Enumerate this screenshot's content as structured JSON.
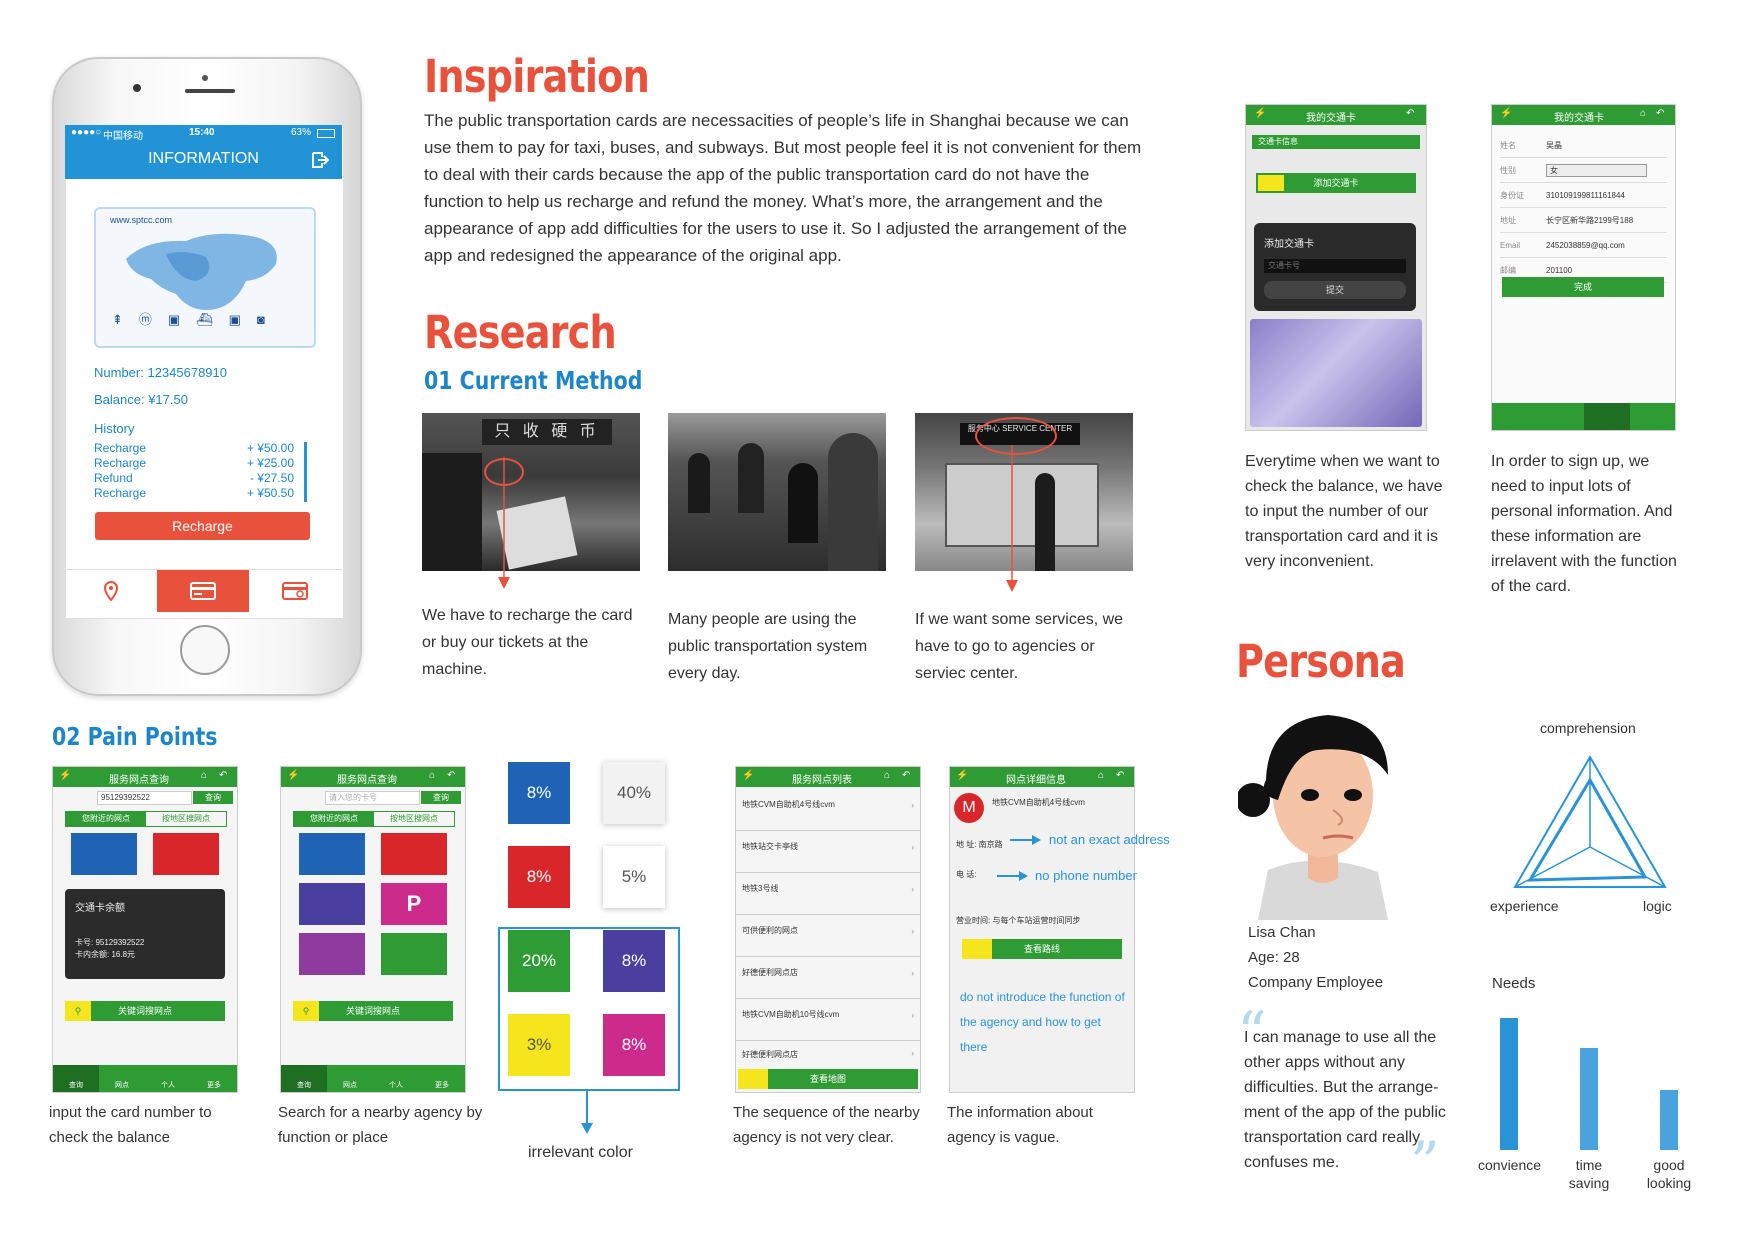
{
  "phone": {
    "status_carrier": "中国移动",
    "status_time": "15:40",
    "status_battery": "63%",
    "header_title": "INFORMATION",
    "card_url": "www.sptcc.com",
    "number": "Number: 12345678910",
    "balance": "Balance: ¥17.50",
    "history_label": "History",
    "history": [
      {
        "type": "Recharge",
        "amount": "+ ¥50.00"
      },
      {
        "type": "Recharge",
        "amount": "+ ¥25.00"
      },
      {
        "type": "Refund",
        "amount": "- ¥27.50"
      },
      {
        "type": "Recharge",
        "amount": "+ ¥50.50"
      }
    ],
    "recharge_button": "Recharge"
  },
  "inspiration": {
    "title": "Inspiration",
    "text": "The public transportation cards are necessacities of people’s life in Shanghai because we can use them to pay for taxi, buses, and subways. But most people feel it is not convenient for them to deal with their cards because the app of the public transportation card do not have the function to help us recharge and refund the money. What’s more, the arrangement and the appearance of app add difficulties for the users to use it. So I adjusted the arrangement of the app and redesigned the appearance of the original app."
  },
  "research": {
    "title": "Research",
    "subtitle": "01 Current Method",
    "photo_signs": [
      "只 收 硬 币",
      "服务中心 SERVICE CENTER"
    ],
    "captions": [
      "We have to recharge the card or buy our tickets at the machine.",
      "Many people are using the public transportation system every day.",
      "If we want some services, we have to go to agencies or serviec center."
    ]
  },
  "screens_top": {
    "header": "我的交通卡",
    "screen1": {
      "section": "交通卡信息",
      "add_card": "添加交通卡",
      "dialog_title": "添加交通卡",
      "dialog_field": "交通卡号",
      "dialog_submit": "提交"
    },
    "screen2": {
      "fields": [
        {
          "label": "姓名",
          "value": "吴晶"
        },
        {
          "label": "性别",
          "value": "女"
        },
        {
          "label": "身份证",
          "value": "310109199811161844"
        },
        {
          "label": "地址",
          "value": "长宁区新华路2199号188"
        },
        {
          "label": "Email",
          "value": "2452038859@qq.com"
        },
        {
          "label": "邮编",
          "value": "201100"
        }
      ],
      "submit": "完成"
    },
    "caption1": "Everytime when we want to check the balance, we have to input the number of our transportation card and it is very inconvenient.",
    "caption2": "In order to sign up, we need to input lots of personal information. And these information are irrelavent with the function of the card."
  },
  "persona": {
    "title": "Persona",
    "name": "Lisa Chan",
    "age": "Age: 28",
    "job": "Company Employee",
    "quote": "I can manage to use all the other apps without any difficulties. But the arrange-ment of the app of the public transportation card really confuses me.",
    "triangle_labels": {
      "top": "comprehension",
      "left": "experience",
      "right": "logic"
    },
    "needs_title": "Needs",
    "needs": [
      {
        "label": "convience",
        "value": 0.88
      },
      {
        "label": "time saving",
        "value": 0.68
      },
      {
        "label": "good looking",
        "value": 0.4
      }
    ]
  },
  "pain_points": {
    "title": "02 Pain Points",
    "screen_header_a": "服务网点查询",
    "search_value_1": "95129392522",
    "search_placeholder_2": "请入您的卡号",
    "search_button": "查询",
    "tab_near": "您附近的网点",
    "tab_area": "按地区搜网点",
    "popup_title": "交通卡余额",
    "popup_line1": "卡号: 95129392522",
    "popup_line2": "卡内余额: 16.8元",
    "keyword_button": "关键词搜网点",
    "nav": [
      "查询",
      "网点",
      "个人",
      "更多"
    ],
    "captions": [
      "input the card number to check the balance",
      "Search for a nearby agency by function or place",
      "irrelevant color",
      "The sequence of the nearby agency is not very clear.",
      "The information about agency is vague."
    ],
    "color_blocks": [
      {
        "value": "8%",
        "color": "#1f63b4"
      },
      {
        "value": "40%",
        "color": "#f2f2f2"
      },
      {
        "value": "8%",
        "color": "#d8262a"
      },
      {
        "value": "5%",
        "color": "#ffffff"
      },
      {
        "value": "20%",
        "color": "#2f9b34"
      },
      {
        "value": "8%",
        "color": "#4a3f9f"
      },
      {
        "value": "3%",
        "color": "#f5e51c"
      },
      {
        "value": "8%",
        "color": "#cc2b8c"
      }
    ],
    "list_header": "服务网点列表",
    "list_items": [
      "地铁CVM自助机4号线cvm",
      "地铁站交卡亭线",
      "地铁3号线",
      "可供便利的网点",
      "好德便利网点店",
      "地铁CVM自助机10号线cvm",
      "好德便利网点店"
    ],
    "map_button": "查看地图",
    "detail_header": "网点详细信息",
    "detail_name": "地铁CVM自助机4号线cvm",
    "detail_addr_label": "地 址: 南京路",
    "detail_phone_label": "电 话:",
    "detail_hours": "营业时间: 与每个车站运营时间同步",
    "detail_route": "查看路线",
    "annot_address": "not an exact address",
    "annot_phone": "no phone number",
    "annot_function": "do not introduce the function of the agency and how to get there"
  },
  "colors": {
    "accent_red": "#e8523c",
    "accent_blue": "#1e86c8",
    "app_green": "#2f9b34",
    "app_blue": "#2294d6"
  }
}
